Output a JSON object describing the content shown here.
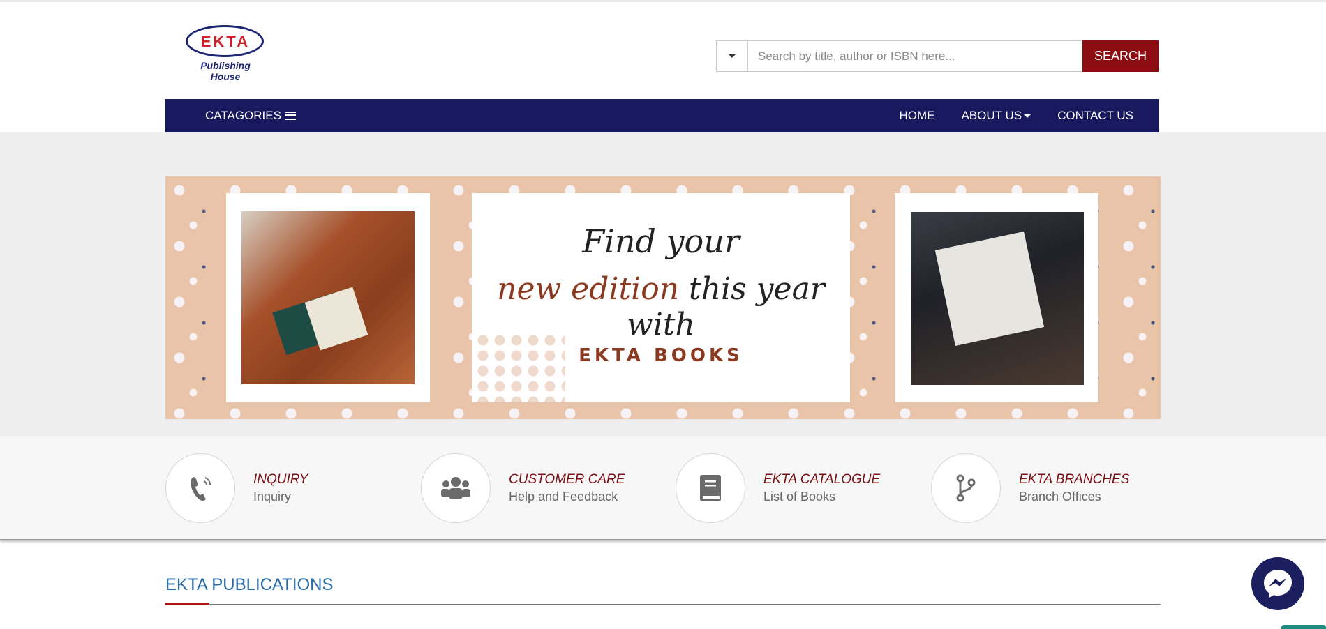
{
  "header": {
    "logo_brand": "EKTA",
    "logo_sub": "Publishing House",
    "search_placeholder": "Search by title, author or ISBN here...",
    "search_button": "SEARCH"
  },
  "nav": {
    "categories": "CATAGORIES",
    "home": "HOME",
    "about": "ABOUT US",
    "contact": "CONTACT US"
  },
  "banner": {
    "line1": "Find your",
    "line2_accent": "new edition",
    "line2": " this year with",
    "line3": "EKTA BOOKS"
  },
  "features": [
    {
      "title": "INQUIRY",
      "subtitle": "Inquiry",
      "icon": "phone-icon"
    },
    {
      "title": "CUSTOMER CARE",
      "subtitle": "Help and Feedback",
      "icon": "users-icon"
    },
    {
      "title": "EKTA CATALOGUE",
      "subtitle": "List of Books",
      "icon": "book-icon"
    },
    {
      "title": "EKTA BRANCHES",
      "subtitle": "Branch Offices",
      "icon": "branch-icon"
    }
  ],
  "section": {
    "title": "EKTA PUBLICATIONS"
  },
  "colors": {
    "nav_bg": "#18195e",
    "search_button": "#8b0d12",
    "feature_title": "#7a1015",
    "section_title": "#2a6aa8"
  }
}
